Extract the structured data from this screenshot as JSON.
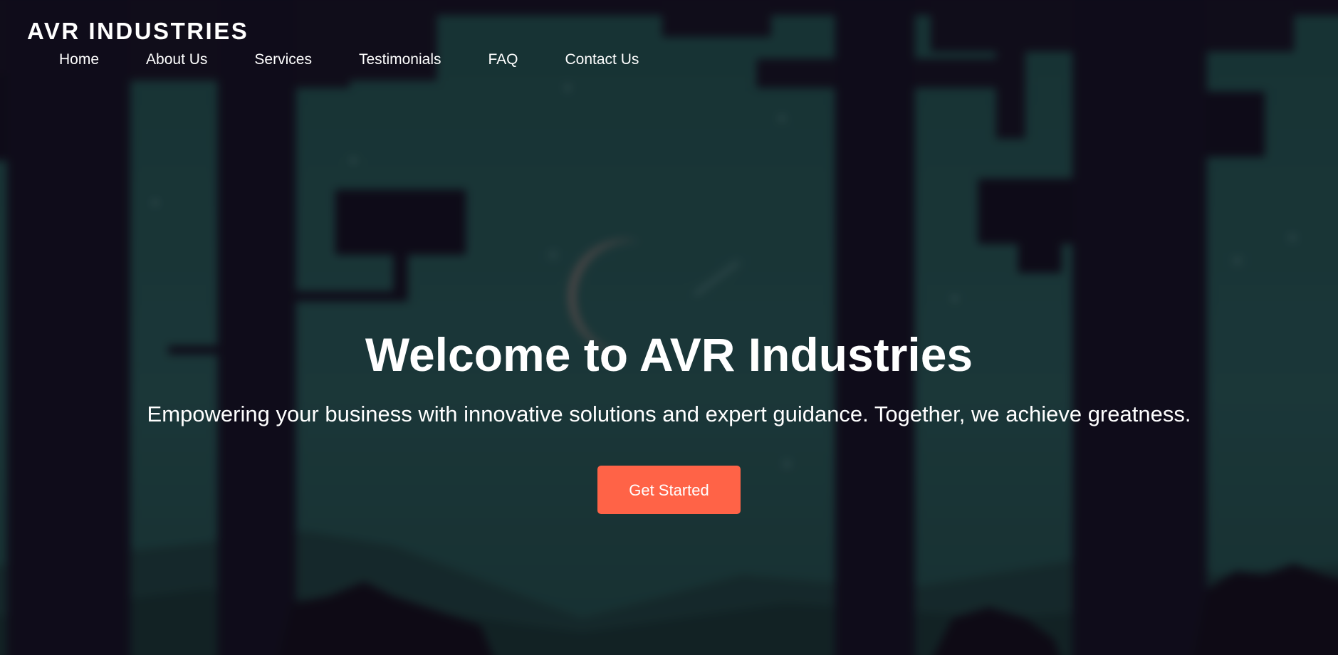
{
  "header": {
    "brand": "AVR INDUSTRIES",
    "nav": [
      {
        "label": "Home"
      },
      {
        "label": "About Us"
      },
      {
        "label": "Services"
      },
      {
        "label": "Testimonials"
      },
      {
        "label": "FAQ"
      },
      {
        "label": "Contact Us"
      }
    ]
  },
  "hero": {
    "title": "Welcome to AVR Industries",
    "subtitle": "Empowering your business with innovative solutions and expert guidance. Together, we achieve greatness.",
    "cta_label": "Get Started"
  },
  "colors": {
    "accent": "#ff6347",
    "sky": "#1f4443",
    "dark": "#120f1c"
  }
}
